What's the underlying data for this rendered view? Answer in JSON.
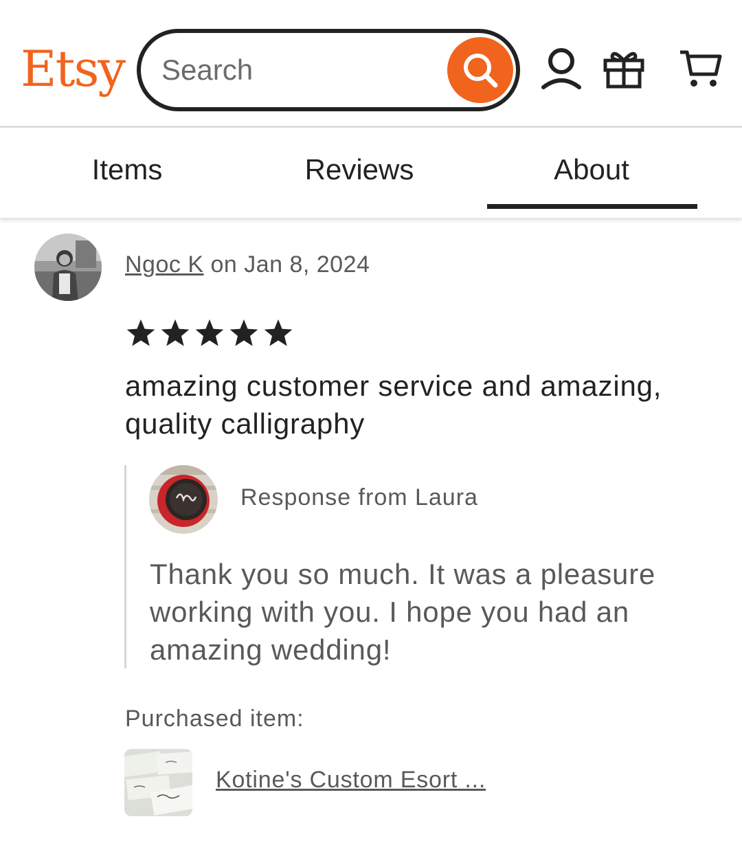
{
  "header": {
    "logo": "Etsy",
    "search": {
      "placeholder": "Search",
      "value": ""
    },
    "icons": [
      "search-icon",
      "account-icon",
      "gift-icon",
      "cart-icon"
    ]
  },
  "tabs": [
    {
      "label": "Items",
      "active": false
    },
    {
      "label": "Reviews",
      "active": false
    },
    {
      "label": "About",
      "active": true
    }
  ],
  "review": {
    "reviewer": "Ngoc K",
    "date_text": " on Jan 8, 2024",
    "rating": 5,
    "text": "amazing customer service and amazing, quality calligraphy",
    "response": {
      "label": "Response from Laura",
      "text": "Thank you so much. It was a pleasure working with you. I hope you had an amazing wedding!"
    },
    "purchased_label": "Purchased item:",
    "purchased_item": "Kotine's Custom Esort ..."
  },
  "colors": {
    "brand": "#f1641e",
    "text": "#222222",
    "muted": "#595959"
  }
}
